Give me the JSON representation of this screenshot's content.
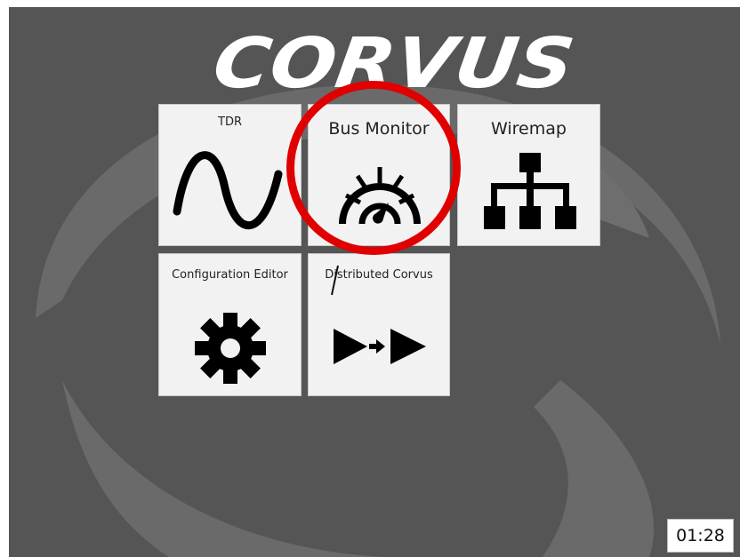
{
  "app": {
    "brand": "CORVUS",
    "colors": {
      "background": "#555555",
      "watermark": "#6a6a6a",
      "tile": "#f2f2f2",
      "icon": "#000000",
      "highlight": "#e00000"
    }
  },
  "tiles": [
    {
      "label": "TDR",
      "icon": "sine-wave-icon"
    },
    {
      "label": "Bus Monitor",
      "icon": "speedometer-icon"
    },
    {
      "label": "Wiremap",
      "icon": "network-hierarchy-icon"
    },
    {
      "label": "Configuration Editor",
      "icon": "gear-icon"
    },
    {
      "label": "Distributed Corvus",
      "icon": "forward-arrows-icon"
    }
  ],
  "timer": "01:28"
}
